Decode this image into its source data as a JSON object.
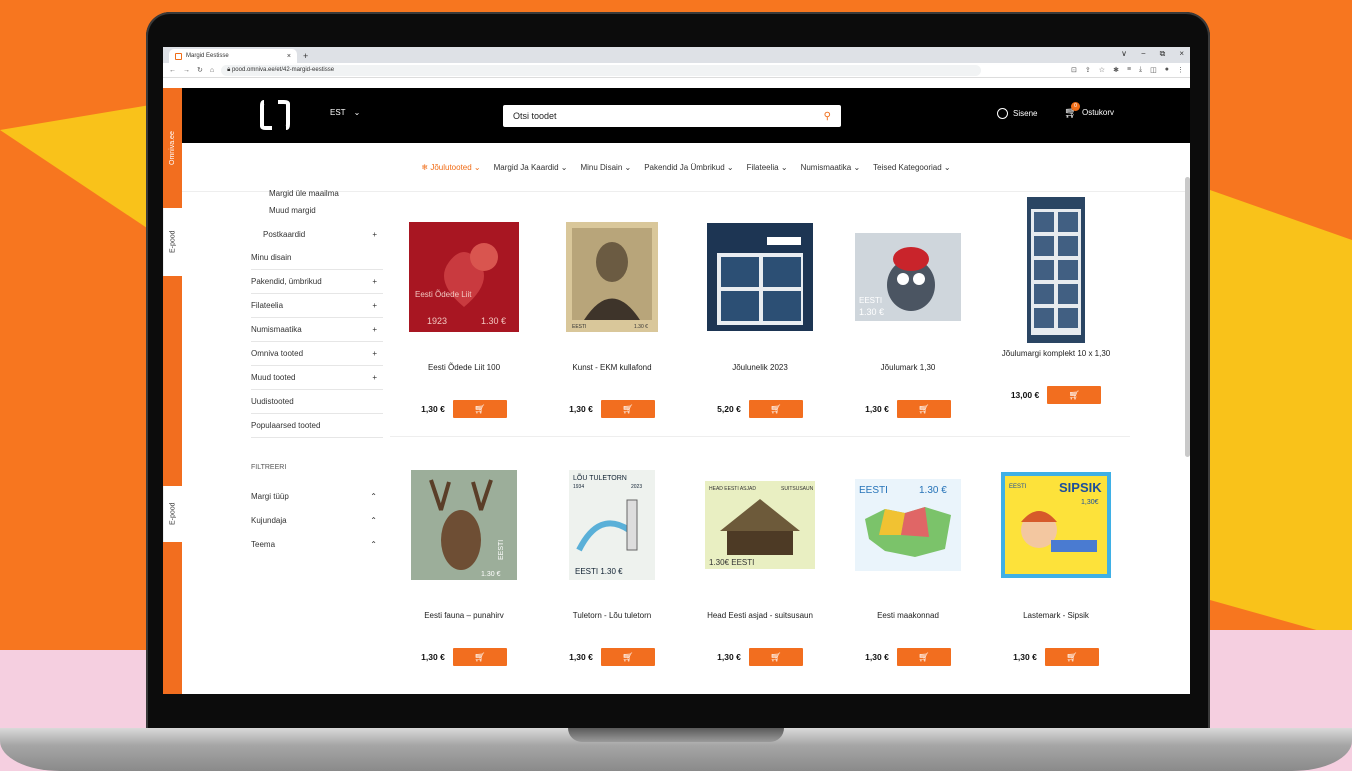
{
  "browser": {
    "tab_title": "Margid Eestisse",
    "tab_close": "×",
    "new_tab": "+",
    "url": "pood.omniva.ee/et/42-margid-eestisse",
    "window_controls": [
      "∨",
      "−",
      "⧉",
      "×"
    ]
  },
  "header": {
    "language": "EST",
    "search_placeholder": "Otsi toodet",
    "login_label": "Sisene",
    "cart_label": "Ostukorv",
    "cart_count": "0"
  },
  "side_tabs": {
    "top": "Omniva.ee",
    "middle": "E-pood",
    "bottom": "E-pood"
  },
  "nav": [
    {
      "label": "❄ Jõulutooted ⌄",
      "highlight": true
    },
    {
      "label": "Margid Ja Kaardid ⌄"
    },
    {
      "label": "Minu Disain ⌄"
    },
    {
      "label": "Pakendid Ja Ümbrikud ⌄"
    },
    {
      "label": "Filateelia ⌄"
    },
    {
      "label": "Numismaatika ⌄"
    },
    {
      "label": "Teised Kategooriad ⌄"
    }
  ],
  "sidebar": {
    "items": [
      {
        "label": "Margid üle maailma",
        "level": 2,
        "plus": ""
      },
      {
        "label": "Muud margid",
        "level": 2,
        "plus": ""
      },
      {
        "label": "Postkaardid",
        "level": 1,
        "plus": "+"
      },
      {
        "label": "Minu disain",
        "level": 0,
        "plus": ""
      },
      {
        "label": "Pakendid, ümbrikud",
        "level": 0,
        "plus": "+"
      },
      {
        "label": "Filateelia",
        "level": 0,
        "plus": "+"
      },
      {
        "label": "Numismaatika",
        "level": 0,
        "plus": "+"
      },
      {
        "label": "Omniva tooted",
        "level": 0,
        "plus": "+"
      },
      {
        "label": "Muud tooted",
        "level": 0,
        "plus": "+"
      },
      {
        "label": "Uudistooted",
        "level": 0,
        "plus": ""
      },
      {
        "label": "Populaarsed tooted",
        "level": 0,
        "plus": ""
      }
    ],
    "filter_title": "FILTREERI",
    "filters": [
      "Margi tüüp",
      "Kujundaja",
      "Teema"
    ]
  },
  "products": [
    [
      {
        "name": "Eesti Õdede Liit 100",
        "price": "1,30 €",
        "stamp_text": "Eesti Õdede Liit",
        "stamp_year": "1923",
        "stamp_value": "1.30 €"
      },
      {
        "name": "Kunst - EKM kullafond",
        "price": "1,30 €",
        "stamp_text": "EESTI",
        "stamp_value": "1.30 €"
      },
      {
        "name": "Jõulunelik 2023",
        "price": "5,20 €"
      },
      {
        "name": "Jõulumark 1,30",
        "price": "1,30 €",
        "stamp_text": "EESTI",
        "stamp_value": "1.30 €"
      },
      {
        "name": "Jõulumargi komplekt 10 x 1,30",
        "price": "13,00 €"
      }
    ],
    [
      {
        "name": "Eesti fauna – punahirv",
        "price": "1,30 €",
        "stamp_text": "EESTI",
        "stamp_value": "1.30 €"
      },
      {
        "name": "Tuletorn - Lõu tuletorn",
        "price": "1,30 €",
        "stamp_text": "LÕU TULETORN",
        "stamp_year": "1934",
        "stamp_year2": "2023",
        "stamp_value": "EESTI 1.30 €"
      },
      {
        "name": "Head Eesti asjad - suitsusaun",
        "price": "1,30 €",
        "stamp_text": "HEAD EESTI ASJAD",
        "stamp_text2": "SUITSUSAUN",
        "stamp_value": "1.30€ EESTI"
      },
      {
        "name": "Eesti maakonnad",
        "price": "1,30 €",
        "stamp_text": "EESTI",
        "stamp_value": "1.30 €"
      },
      {
        "name": "Lastemark - Sipsik",
        "price": "1,30 €",
        "stamp_text": "SIPSIK",
        "stamp_country": "EESTI",
        "stamp_value": "1,30€"
      }
    ]
  ],
  "icons": {
    "cart_button": "cart-icon",
    "search": "search-icon",
    "account": "user-icon"
  },
  "colors": {
    "accent": "#f26e1f",
    "header_bg": "#000000"
  }
}
